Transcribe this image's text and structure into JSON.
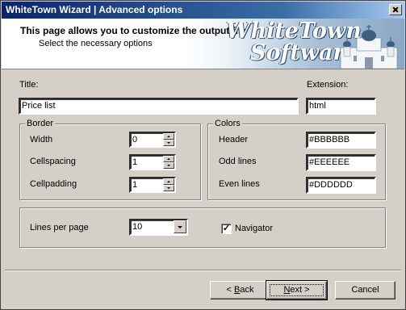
{
  "window": {
    "title": "WhiteTown Wizard | Advanced options"
  },
  "header": {
    "title": "This page allows you to customize the output file",
    "subtitle": "Select the necessary options",
    "brand_line1": "WhiteTown",
    "brand_line2": "Software"
  },
  "fields": {
    "title_label": "Title:",
    "title_value": "Price list",
    "extension_label": "Extension:",
    "extension_value": "html"
  },
  "border": {
    "legend": "Border",
    "width_label": "Width",
    "width_value": "0",
    "cellspacing_label": "Cellspacing",
    "cellspacing_value": "1",
    "cellpadding_label": "Cellpadding",
    "cellpadding_value": "1"
  },
  "colors": {
    "legend": "Colors",
    "header_label": "Header",
    "header_value": "#BBBBBB",
    "odd_label": "Odd lines",
    "odd_value": "#EEEEEE",
    "even_label": "Even lines",
    "even_value": "#DDDDDD"
  },
  "paging": {
    "lines_label": "Lines per page",
    "lines_value": "10",
    "navigator_label": "Navigator",
    "navigator_checked": true,
    "check_glyph": "✓"
  },
  "buttons": {
    "back_prefix": "< ",
    "back_mnemonic": "B",
    "back_rest": "ack",
    "next_mnemonic": "N",
    "next_rest": "ext >",
    "cancel": "Cancel"
  },
  "icons": {
    "close": "close-icon",
    "spin_up": "spin-up-icon",
    "spin_down": "spin-down-icon",
    "dropdown": "chevron-down-icon",
    "church": "church-icon"
  },
  "palette": {
    "titlebar_start": "#0a246a",
    "titlebar_end": "#a6caf0",
    "dialog_bg": "#d4d0c8"
  }
}
